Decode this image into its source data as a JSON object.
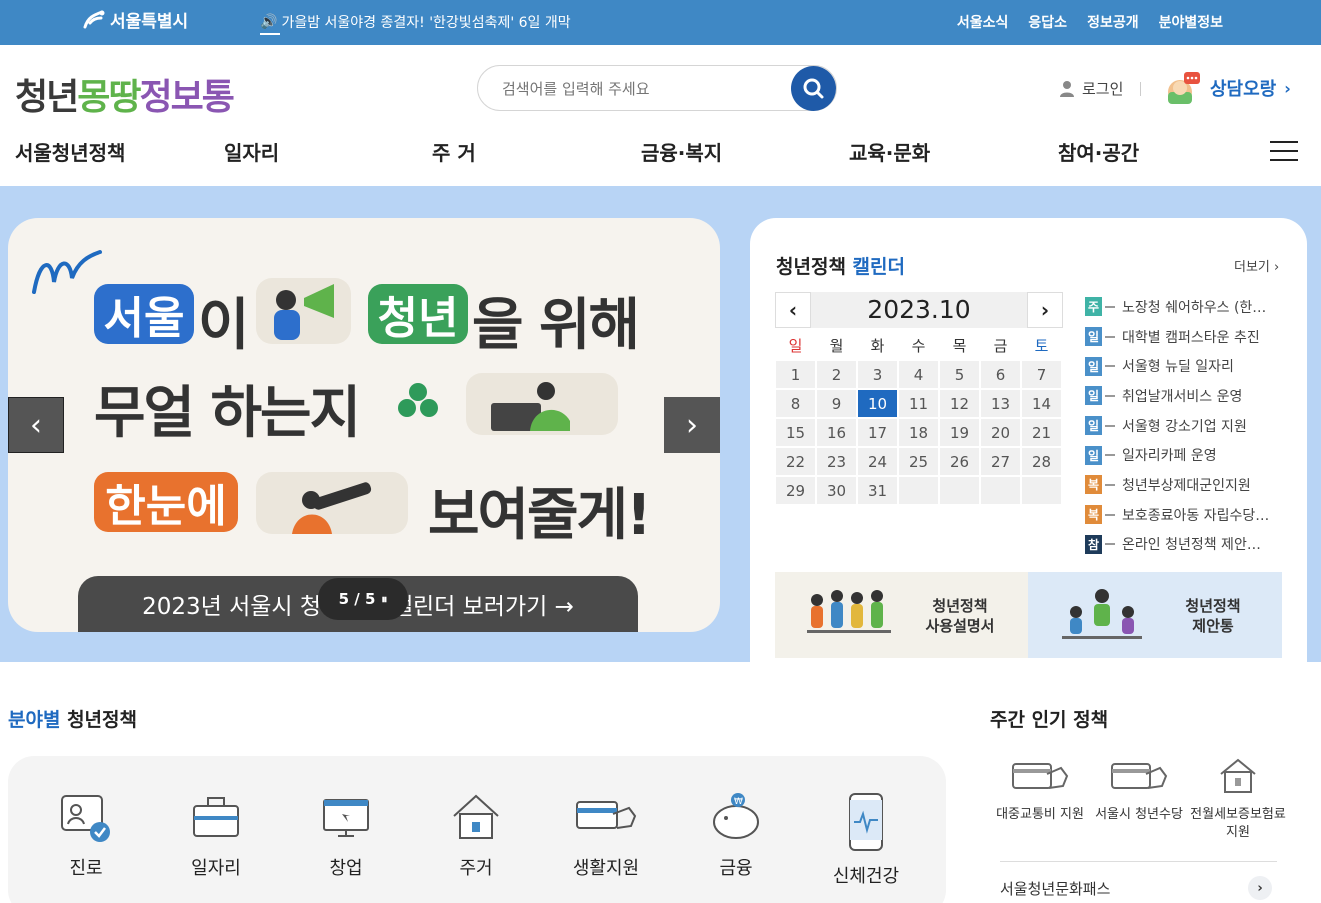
{
  "topbar": {
    "logo": "서울특별시",
    "notice": "가을밤 서울야경 종결자! '한강빛섬축제' 6일 개막",
    "links": [
      "서울소식",
      "응답소",
      "정보공개",
      "분야별정보"
    ]
  },
  "header": {
    "brand": [
      "청년",
      "몽땅",
      "정보통"
    ],
    "search_placeholder": "검색어를 입력해 주세요",
    "login": "로그인",
    "counsel": "상담오랑"
  },
  "nav": [
    "서울청년정책",
    "일자리",
    "주 거",
    "금융·복지",
    "교육·문화",
    "참여·공간"
  ],
  "banner": {
    "line1_a": "서울",
    "line1_b": "이",
    "line1_c": "청년",
    "line1_d": "을 위해",
    "line2": "무얼 하는지",
    "line3_a": "한눈에",
    "line3_b": "보여줄게!",
    "caption": "2023년 서울시 청년정책 캘린더 보러가기 →",
    "counter": "5 / 5",
    "pause": "⏸"
  },
  "calendar": {
    "title_a": "청년정책",
    "title_b": "캘린더",
    "more": "더보기",
    "month": "2023.10",
    "dow": [
      "일",
      "월",
      "화",
      "수",
      "목",
      "금",
      "토"
    ],
    "days": [
      "1",
      "2",
      "3",
      "4",
      "5",
      "6",
      "7",
      "8",
      "9",
      "10",
      "11",
      "12",
      "13",
      "14",
      "15",
      "16",
      "17",
      "18",
      "19",
      "20",
      "21",
      "22",
      "23",
      "24",
      "25",
      "26",
      "27",
      "28",
      "29",
      "30",
      "31",
      "",
      "",
      "",
      ""
    ],
    "today": "10",
    "events": [
      {
        "tag": "주",
        "color": "#3fb3a6",
        "text": "노장청 쉐어하우스 (한…"
      },
      {
        "tag": "일",
        "color": "#4a90c9",
        "text": "대학별 캠퍼스타운 추진"
      },
      {
        "tag": "일",
        "color": "#4a90c9",
        "text": "서울형 뉴딜 일자리"
      },
      {
        "tag": "일",
        "color": "#4a90c9",
        "text": "취업날개서비스 운영"
      },
      {
        "tag": "일",
        "color": "#4a90c9",
        "text": "서울형 강소기업 지원"
      },
      {
        "tag": "일",
        "color": "#4a90c9",
        "text": "일자리카페 운영"
      },
      {
        "tag": "복",
        "color": "#e08b3a",
        "text": "청년부상제대군인지원"
      },
      {
        "tag": "복",
        "color": "#e08b3a",
        "text": "보호종료아동 자립수당…"
      },
      {
        "tag": "참",
        "color": "#1e3b5a",
        "text": "온라인 청년정책 제안…"
      }
    ],
    "guide1": "청년정책\n사용설명서",
    "guide2": "청년정책\n제안통"
  },
  "categories": {
    "title_a": "분야별",
    "title_b": "청년정책",
    "items": [
      "진로",
      "일자리",
      "창업",
      "주거",
      "생활지원",
      "금융",
      "신체건강"
    ]
  },
  "weekly": {
    "title": "주간 인기 정책",
    "items": [
      "대중교통비 지원",
      "서울시 청년수당",
      "전월세보증보험료 지원"
    ],
    "pass": "서울청년문화패스"
  },
  "colors": {
    "topbar": "#3f88c5",
    "hero_bg": "#b8d4f5",
    "accent_blue": "#1f6ac0",
    "brand_green": "#5fb34b",
    "brand_purple": "#8a56b2"
  }
}
